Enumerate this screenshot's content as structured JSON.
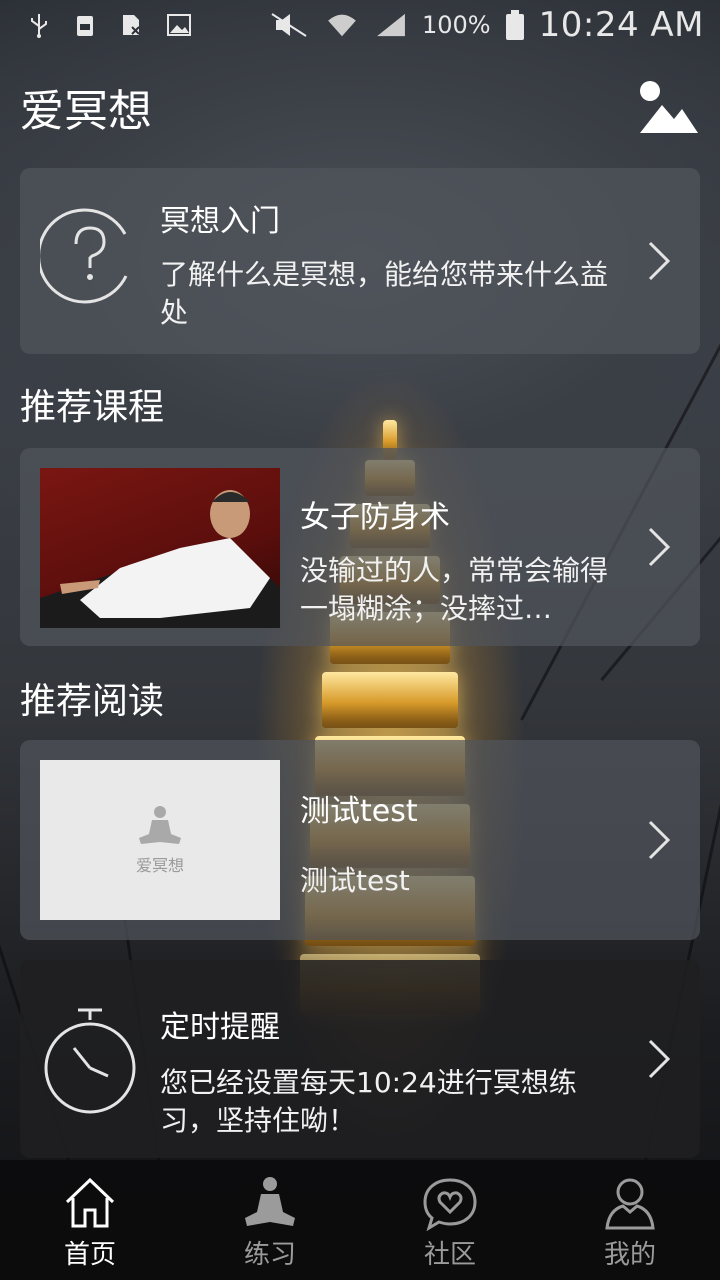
{
  "status_bar": {
    "battery_percent": "100%",
    "time": "10:24 AM"
  },
  "header": {
    "title": "爱冥想"
  },
  "intro_card": {
    "title": "冥想入门",
    "description": "了解什么是冥想，能给您带来什么益处"
  },
  "recommended_courses": {
    "section_title": "推荐课程",
    "items": [
      {
        "title": "女子防身术",
        "description": "没输过的人，常常会输得一塌糊涂；没摔过…"
      }
    ]
  },
  "recommended_reading": {
    "section_title": "推荐阅读",
    "items": [
      {
        "title": "测试test",
        "description": "测试test",
        "thumb_logo_text": "爱冥想"
      }
    ]
  },
  "reminder_card": {
    "title": "定时提醒",
    "description": "您已经设置每天10:24进行冥想练习，坚持住呦！"
  },
  "bottom_nav": {
    "items": [
      {
        "label": "首页",
        "icon": "home-icon",
        "active": true
      },
      {
        "label": "练习",
        "icon": "meditation-icon",
        "active": false
      },
      {
        "label": "社区",
        "icon": "chat-heart-icon",
        "active": false
      },
      {
        "label": "我的",
        "icon": "profile-icon",
        "active": false
      }
    ]
  }
}
